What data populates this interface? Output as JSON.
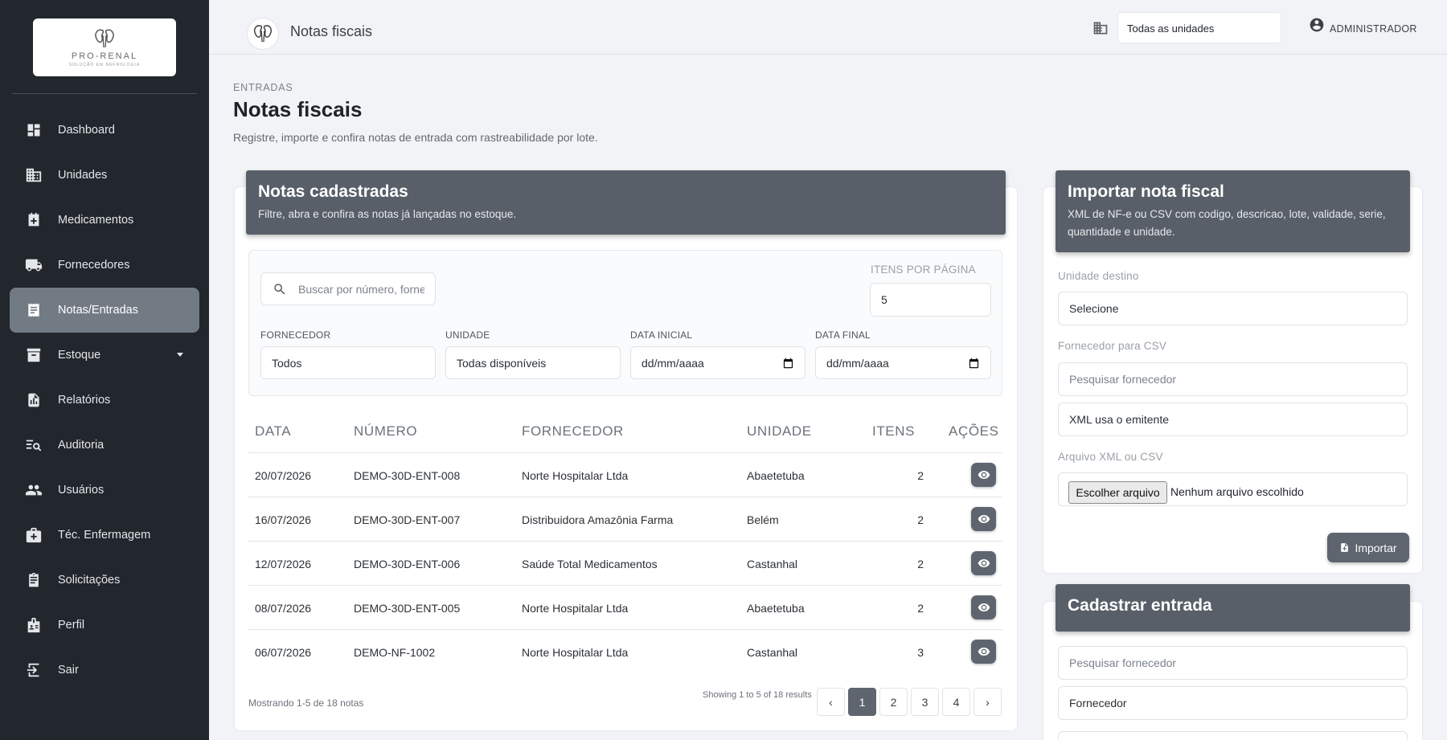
{
  "app": {
    "logo_text": "PRO-RENAL",
    "logo_subtext": "SOLUÇÃO EM NEFROLOGIA"
  },
  "sidebar": {
    "items": [
      {
        "label": "Dashboard",
        "icon": "dashboard-icon"
      },
      {
        "label": "Unidades",
        "icon": "building-icon"
      },
      {
        "label": "Medicamentos",
        "icon": "medical-icon"
      },
      {
        "label": "Fornecedores",
        "icon": "truck-icon"
      },
      {
        "label": "Notas/Entradas",
        "icon": "receipt-icon",
        "active": true
      },
      {
        "label": "Estoque",
        "icon": "archive-icon",
        "has_submenu": true
      },
      {
        "label": "Relatórios",
        "icon": "report-icon"
      },
      {
        "label": "Auditoria",
        "icon": "audit-search-icon"
      },
      {
        "label": "Usuários",
        "icon": "users-icon"
      },
      {
        "label": "Téc. Enfermagem",
        "icon": "medical-bag-icon"
      },
      {
        "label": "Solicitações",
        "icon": "clipboard-icon"
      },
      {
        "label": "Perfil",
        "icon": "badge-icon"
      },
      {
        "label": "Sair",
        "icon": "logout-icon"
      }
    ]
  },
  "topbar": {
    "title": "Notas fiscais",
    "unit_select": "Todas as unidades",
    "user": "ADMINISTRADOR"
  },
  "page": {
    "breadcrumb": "ENTRADAS",
    "title": "Notas fiscais",
    "subtitle": "Registre, importe e confira notas de entrada com rastreabilidade por lote."
  },
  "notes_card": {
    "title": "Notas cadastradas",
    "subtitle": "Filtre, abra e confira as notas já lançadas no estoque.",
    "search_placeholder": "Buscar por número, forne",
    "per_page_label": "ITENS POR PÁGINA",
    "per_page_value": "5",
    "filters": {
      "supplier_label": "FORNECEDOR",
      "supplier_value": "Todos",
      "unit_label": "UNIDADE",
      "unit_value": "Todas disponíveis",
      "start_label": "DATA INICIAL",
      "start_value": "dd/mm/aaaa",
      "end_label": "DATA FINAL",
      "end_value": "dd/mm/aaaa"
    },
    "columns": [
      "DATA",
      "NÚMERO",
      "FORNECEDOR",
      "UNIDADE",
      "ITENS",
      "AÇÕES"
    ],
    "rows": [
      {
        "date": "20/07/2026",
        "number": "DEMO-30D-ENT-008",
        "supplier": "Norte Hospitalar Ltda",
        "unit": "Abaetetuba",
        "items": "2"
      },
      {
        "date": "16/07/2026",
        "number": "DEMO-30D-ENT-007",
        "supplier": "Distribuidora Amazônia Farma",
        "unit": "Belém",
        "items": "2"
      },
      {
        "date": "12/07/2026",
        "number": "DEMO-30D-ENT-006",
        "supplier": "Saúde Total Medicamentos",
        "unit": "Castanhal",
        "items": "2"
      },
      {
        "date": "08/07/2026",
        "number": "DEMO-30D-ENT-005",
        "supplier": "Norte Hospitalar Ltda",
        "unit": "Abaetetuba",
        "items": "2"
      },
      {
        "date": "06/07/2026",
        "number": "DEMO-NF-1002",
        "supplier": "Norte Hospitalar Ltda",
        "unit": "Castanhal",
        "items": "3"
      }
    ],
    "summary": "Mostrando 1-5 de 18 notas",
    "showing": "Showing 1 to 5 of 18 results",
    "pagination": {
      "prev": "‹",
      "pages": [
        "1",
        "2",
        "3",
        "4"
      ],
      "active": "1",
      "next": "›"
    }
  },
  "import_card": {
    "title": "Importar nota fiscal",
    "subtitle": "XML de NF-e ou CSV com codigo, descricao, lote, validade, serie, quantidade e unidade.",
    "unit_label": "Unidade destino",
    "unit_value": "Selecione",
    "supplier_label": "Fornecedor para CSV",
    "supplier_search_placeholder": "Pesquisar fornecedor",
    "supplier_value": "XML usa o emitente",
    "file_label": "Arquivo XML ou CSV",
    "file_button": "Escolher arquivo",
    "file_none": "Nenhum arquivo escolhido",
    "import_button": "Importar"
  },
  "entry_card": {
    "title": "Cadastrar entrada",
    "supplier_search_placeholder": "Pesquisar fornecedor",
    "supplier_value": "Fornecedor"
  },
  "colors": {
    "sidebar_bg": "#22262d",
    "accent": "#585f69",
    "active_nav": "#727a84"
  }
}
